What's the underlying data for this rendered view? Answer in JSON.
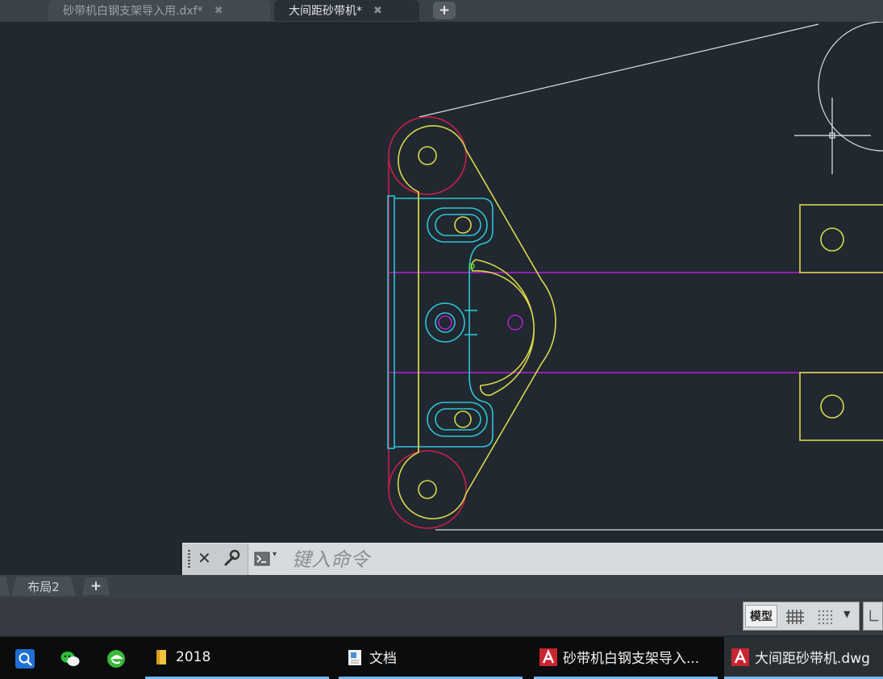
{
  "tabs": [
    {
      "label": "砂带机白钢支架导入用.dxf*",
      "close": "✖",
      "active": false
    },
    {
      "label": "大间距砂带机*",
      "close": "✖",
      "active": true
    }
  ],
  "tab_add_label": "+",
  "command_line": {
    "close_label": "✕",
    "placeholder": "键入命令",
    "caret": "▾"
  },
  "layout_tabs": [
    {
      "label": "布局2"
    }
  ],
  "layout_add_label": "+",
  "status": {
    "model_label": "模型",
    "dropdown_caret": "▼"
  },
  "taskbar": [
    {
      "label": "2018",
      "icon": "folder-icon"
    },
    {
      "label": "文档",
      "icon": "document-icon"
    },
    {
      "label": "砂带机白钢支架导入...",
      "icon": "autocad-icon"
    },
    {
      "label": "大间距砂带机.dwg",
      "icon": "autocad-icon"
    }
  ],
  "colors": {
    "canvas_bg": "#212830",
    "yellow": "#d8d84a",
    "cyan": "#2ec4d6",
    "magenta": "#b21fd0",
    "red": "#c81f4b",
    "white": "#d9dde0"
  }
}
